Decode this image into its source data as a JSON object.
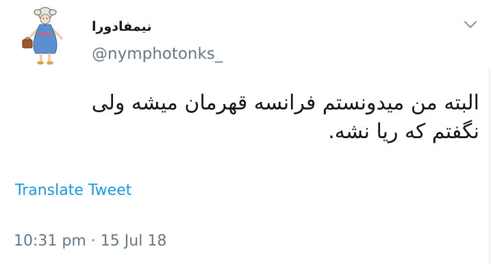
{
  "tweet": {
    "author": {
      "display_name": "نیمفادورا",
      "handle": "@nymphotonks_"
    },
    "text": "البته من میدونستم فرانسه قهرمان میشه ولی نگفتم که ریا نشه.",
    "translate_label": "Translate Tweet",
    "time": "10:31 pm",
    "separator": "·",
    "date": "15 Jul 18"
  },
  "colors": {
    "text": "#14171a",
    "secondary": "#657786",
    "link": "#1b95e0",
    "background": "#ffffff"
  },
  "icons": {
    "menu": "chevron-down-icon",
    "avatar": "cartoon-girl-avatar"
  }
}
